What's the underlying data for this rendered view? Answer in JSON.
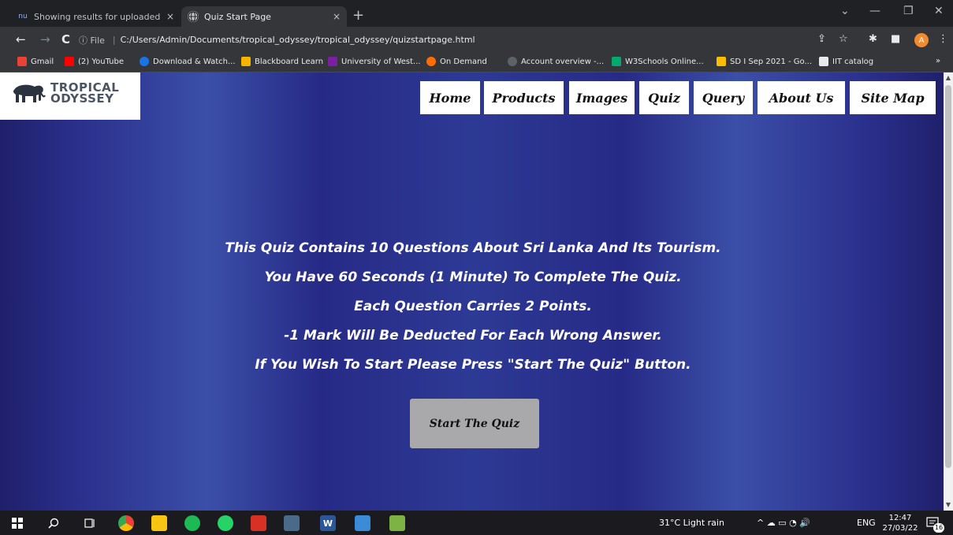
{
  "browser": {
    "tabs": [
      {
        "favicon": "nu",
        "title": "Showing results for uploaded file",
        "close": "×"
      },
      {
        "favicon": "globe-icon",
        "title": "Quiz Start Page",
        "close": "×"
      }
    ],
    "new_tab": "+",
    "window_controls": {
      "dropdown": "⌄",
      "minimize": "—",
      "restore": "❐",
      "close": "✕"
    },
    "nav": {
      "back": "←",
      "forward": "→",
      "reload": "C"
    },
    "address": {
      "info": "ⓘ File",
      "url": "C:/Users/Admin/Documents/tropical_odyssey/tropical_odyssey/quizstartpage.html"
    },
    "toolbar_icons": {
      "share": "⇪",
      "star": "☆",
      "extensions": "✱",
      "sidepanel": "■",
      "menu": "⋮"
    },
    "profile_initial": "A",
    "bookmarks": [
      {
        "label": "Gmail",
        "color": "#ea4335"
      },
      {
        "label": "(2) YouTube",
        "color": "#ff0000"
      },
      {
        "label": "Download & Watch...",
        "color": "#1a73e8"
      },
      {
        "label": "Blackboard Learn",
        "color": "#f5b400"
      },
      {
        "label": "University of West...",
        "color": "#7b1fa2"
      },
      {
        "label": "On Demand",
        "color": "#ff6d00"
      },
      {
        "label": "Account overview -...",
        "color": "#5f6368"
      },
      {
        "label": "W3Schools Online...",
        "color": "#04aa6d"
      },
      {
        "label": "SD I Sep 2021 - Go...",
        "color": "#fbbc04"
      },
      {
        "label": "IIT catalog",
        "color": "#e8eaed"
      }
    ],
    "bookmarks_more": "»"
  },
  "site": {
    "logo": {
      "line1": "TROPICAL",
      "line2": "ODYSSEY"
    },
    "nav": [
      "Home",
      "Products",
      "Images",
      "Quiz",
      "Query",
      "About Us",
      "Site Map"
    ]
  },
  "quiz": {
    "lines": [
      "This Quiz Contains 10 Questions About Sri Lanka And Its Tourism.",
      "You Have 60 Seconds (1 Minute) To Complete The Quiz.",
      "Each Question Carries 2 Points.",
      "-1 Mark Will Be Deducted For Each Wrong Answer.",
      "If You Wish To Start Please Press \"Start The Quiz\" Button."
    ],
    "start_button": "Start The Quiz"
  },
  "taskbar": {
    "weather": "31°C  Light rain",
    "tray_icons": "^  ☁  ▭  ◔  🔊",
    "language": "ENG",
    "time": "12:47",
    "date": "27/03/22",
    "notifications": "16"
  }
}
